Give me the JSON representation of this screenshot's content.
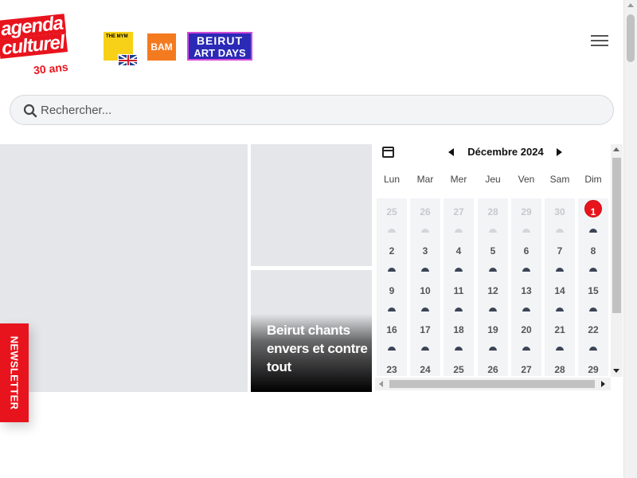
{
  "header": {
    "logo": {
      "line1": "agenda",
      "line2": "culturel",
      "line3": "30 ans"
    },
    "partners": {
      "mym": "THE MYM",
      "bam": "BAM",
      "beirut_art_days_line1": "BEIRUT",
      "beirut_art_days_line2": "ART DAYS"
    },
    "language_flag": "uk-flag"
  },
  "search": {
    "placeholder": "Rechercher..."
  },
  "featured": {
    "bottom_tile_title": "Beirut chants envers et contre tout"
  },
  "calendar": {
    "month_label": "Décembre 2024",
    "weekdays": [
      "Lun",
      "Mar",
      "Mer",
      "Jeu",
      "Ven",
      "Sam",
      "Dim"
    ],
    "weeks": [
      [
        "25",
        "26",
        "27",
        "28",
        "29",
        "30",
        "1"
      ],
      [
        "2",
        "3",
        "4",
        "5",
        "6",
        "7",
        "8"
      ],
      [
        "9",
        "10",
        "11",
        "12",
        "13",
        "14",
        "15"
      ],
      [
        "16",
        "17",
        "18",
        "19",
        "20",
        "21",
        "22"
      ],
      [
        "23",
        "24",
        "25",
        "26",
        "27",
        "28",
        "29"
      ]
    ],
    "today": "1"
  },
  "newsletter": {
    "label": "NEWSLETTER"
  },
  "colors": {
    "brand_red": "#e8141d",
    "tile_gray": "#e5e6e9"
  }
}
